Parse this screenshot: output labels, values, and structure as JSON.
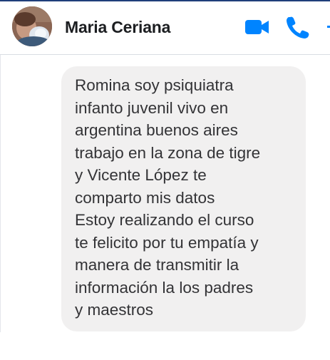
{
  "header": {
    "contact_name": "Maria Ceriana",
    "icons": [
      "avatar",
      "video-camera-icon",
      "phone-icon",
      "info-icon"
    ],
    "accent_color": "#0084ff"
  },
  "message": {
    "text": "Romina soy psiquiatra\ninfanto juvenil vivo en\nargentina buenos aires\ntrabajo en la zona de tigre\ny Vicente López te\ncomparto mis datos\nEstoy realizando el curso\nte felicito por tu empatía y\nmanera de transmitir la\ninformación la los padres\ny maestros",
    "bubble_color": "#f1f0f0"
  }
}
